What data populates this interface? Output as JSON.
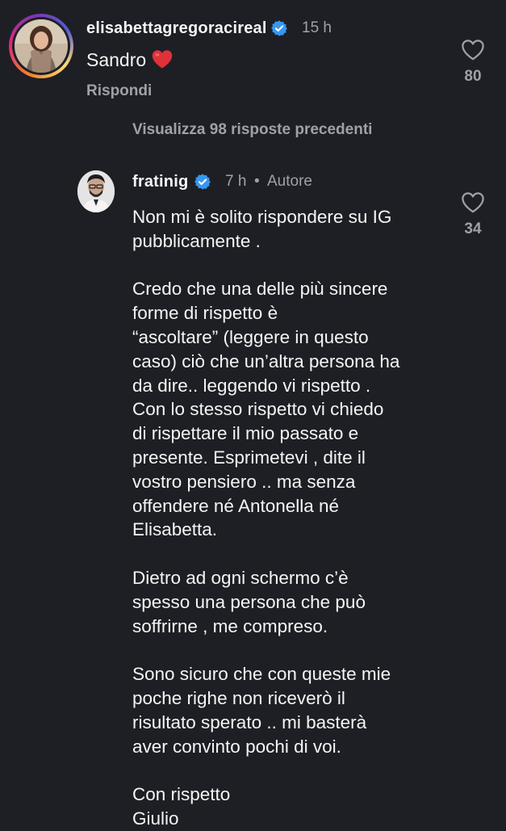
{
  "colors": {
    "background": "#1e1f24",
    "text_primary": "#f5f5f5",
    "text_secondary": "#9ea1a8",
    "verified_blue": "#3797f0",
    "heart_red": "#e0313a"
  },
  "comment": {
    "username": "elisabettagregoracireal",
    "verified": true,
    "time": "15 h",
    "text": "Sandro",
    "emoji": "red-heart",
    "reply_label": "Rispondi",
    "likes": "80",
    "like_icon": "heart-outline-icon"
  },
  "view_previous_replies": "Visualizza 98 risposte precedenti",
  "reply": {
    "username": "fratinig",
    "verified": true,
    "time": "7 h",
    "separator": "•",
    "author_tag": "Autore",
    "likes": "34",
    "like_icon": "heart-outline-icon",
    "paragraphs": [
      "Non mi è solito rispondere su IG\npubblicamente .",
      "Credo che una delle più sincere\nforme di rispetto è\n“ascoltare” (leggere in questo\ncaso) ciò che un’altra persona ha\nda dire.. leggendo vi rispetto .\nCon lo stesso rispetto vi chiedo\ndi rispettare il mio passato e\npresente. Esprimetevi , dite il\nvostro pensiero .. ma senza\noffendere né Antonella né\nElisabetta.",
      "Dietro ad ogni schermo c’è\nspesso una persona che può\nsoffrirne , me compreso.",
      "Sono sicuro che con queste mie\npoche righe non riceverò il\nrisultato sperato .. mi basterà\naver convinto pochi di voi.",
      "Con rispetto\nGiulio"
    ]
  }
}
